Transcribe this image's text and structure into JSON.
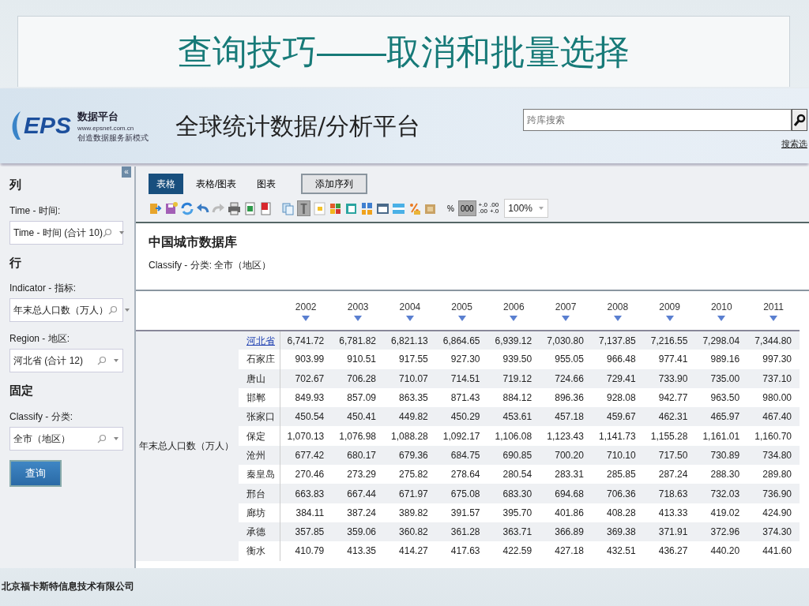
{
  "slide_title": "查询技巧——取消和批量选择",
  "header": {
    "logo": "EPS",
    "logo_name": "数据平台",
    "logo_url": "www.epsnet.com.cn",
    "logo_slogan": "创造数据服务新模式",
    "platform_title": "全球统计数据/分析平台",
    "search": {
      "placeholder": "跨库搜索"
    },
    "search_options": "搜索选"
  },
  "sidebar": {
    "collapse": "«",
    "sections": [
      {
        "heading": "列",
        "fields": [
          {
            "label": "Time - 时间:",
            "value": "Time - 时间 (合计 10)"
          }
        ]
      },
      {
        "heading": "行",
        "fields": [
          {
            "label": "Indicator - 指标:",
            "value": "年末总人口数（万人）"
          },
          {
            "label": "Region - 地区:",
            "value": "河北省 (合计 12)"
          }
        ]
      },
      {
        "heading": "固定",
        "fields": [
          {
            "label": "Classify - 分类:",
            "value": "全市（地区）"
          }
        ]
      }
    ],
    "query_button": "查询"
  },
  "tabs": [
    {
      "label": "表格",
      "selected": true
    },
    {
      "label": "表格/图表",
      "selected": false
    },
    {
      "label": "图表",
      "selected": false
    }
  ],
  "add_series_button": "添加序列",
  "toolbar": [
    {
      "kind": "icon",
      "pressed": false
    },
    {
      "kind": "icon",
      "pressed": false
    },
    {
      "kind": "icon",
      "pressed": false
    },
    {
      "kind": "icon",
      "pressed": false
    },
    {
      "kind": "icon",
      "pressed": false
    },
    {
      "kind": "icon",
      "pressed": false
    },
    {
      "kind": "icon",
      "pressed": false
    },
    {
      "kind": "icon",
      "pressed": false
    },
    {
      "kind": "icon",
      "pressed": false
    },
    {
      "kind": "icon",
      "pressed": true
    },
    {
      "kind": "icon",
      "pressed": false
    },
    {
      "kind": "icon",
      "pressed": false
    },
    {
      "kind": "icon",
      "pressed": false
    },
    {
      "kind": "icon",
      "pressed": false
    },
    {
      "kind": "icon",
      "pressed": false
    },
    {
      "kind": "icon",
      "pressed": false
    },
    {
      "kind": "icon",
      "pressed": false
    },
    {
      "kind": "icon",
      "pressed": false
    },
    {
      "kind": "text",
      "label": "%",
      "pressed": false
    },
    {
      "kind": "text",
      "label": "000",
      "pressed": true
    },
    {
      "kind": "stack",
      "top": "+.0",
      "bottom": ".00",
      "pressed": false
    },
    {
      "kind": "stack",
      "top": ".00",
      "bottom": "+.0",
      "pressed": false
    },
    {
      "kind": "select",
      "value": "100%"
    }
  ],
  "report": {
    "title": "中国城市数据库",
    "subtitle": "Classify - 分类: 全市（地区）"
  },
  "table": {
    "columns": [
      "2002",
      "2003",
      "2004",
      "2005",
      "2006",
      "2007",
      "2008",
      "2009",
      "2010",
      "2011"
    ],
    "row_header": "年末总人口数（万人）",
    "rows": [
      {
        "region": "河北省",
        "link": true,
        "values": [
          "6,741.72",
          "6,781.82",
          "6,821.13",
          "6,864.65",
          "6,939.12",
          "7,030.80",
          "7,137.85",
          "7,216.55",
          "7,298.04",
          "7,344.80"
        ]
      },
      {
        "region": "石家庄",
        "link": false,
        "values": [
          "903.99",
          "910.51",
          "917.55",
          "927.30",
          "939.50",
          "955.05",
          "966.48",
          "977.41",
          "989.16",
          "997.30"
        ]
      },
      {
        "region": "唐山",
        "link": false,
        "values": [
          "702.67",
          "706.28",
          "710.07",
          "714.51",
          "719.12",
          "724.66",
          "729.41",
          "733.90",
          "735.00",
          "737.10"
        ]
      },
      {
        "region": "邯郸",
        "link": false,
        "values": [
          "849.93",
          "857.09",
          "863.35",
          "871.43",
          "884.12",
          "896.36",
          "928.08",
          "942.77",
          "963.50",
          "980.00"
        ]
      },
      {
        "region": "张家口",
        "link": false,
        "values": [
          "450.54",
          "450.41",
          "449.82",
          "450.29",
          "453.61",
          "457.18",
          "459.67",
          "462.31",
          "465.97",
          "467.40"
        ]
      },
      {
        "region": "保定",
        "link": false,
        "values": [
          "1,070.13",
          "1,076.98",
          "1,088.28",
          "1,092.17",
          "1,106.08",
          "1,123.43",
          "1,141.73",
          "1,155.28",
          "1,161.01",
          "1,160.70"
        ]
      },
      {
        "region": "沧州",
        "link": false,
        "values": [
          "677.42",
          "680.17",
          "679.36",
          "684.75",
          "690.85",
          "700.20",
          "710.10",
          "717.50",
          "730.89",
          "734.80"
        ]
      },
      {
        "region": "秦皇岛",
        "link": false,
        "values": [
          "270.46",
          "273.29",
          "275.82",
          "278.64",
          "280.54",
          "283.31",
          "285.85",
          "287.24",
          "288.30",
          "289.80"
        ]
      },
      {
        "region": "邢台",
        "link": false,
        "values": [
          "663.83",
          "667.44",
          "671.97",
          "675.08",
          "683.30",
          "694.68",
          "706.36",
          "718.63",
          "732.03",
          "736.90"
        ]
      },
      {
        "region": "廊坊",
        "link": false,
        "values": [
          "384.11",
          "387.24",
          "389.82",
          "391.57",
          "395.70",
          "401.86",
          "408.28",
          "413.33",
          "419.02",
          "424.90"
        ]
      },
      {
        "region": "承德",
        "link": false,
        "values": [
          "357.85",
          "359.06",
          "360.82",
          "361.28",
          "363.71",
          "366.89",
          "369.38",
          "371.91",
          "372.96",
          "374.30"
        ]
      },
      {
        "region": "衡水",
        "link": false,
        "values": [
          "410.79",
          "413.35",
          "414.27",
          "417.63",
          "422.59",
          "427.18",
          "432.51",
          "436.27",
          "440.20",
          "441.60"
        ]
      }
    ]
  },
  "footer": "北京福卡斯特信息技术有限公司"
}
